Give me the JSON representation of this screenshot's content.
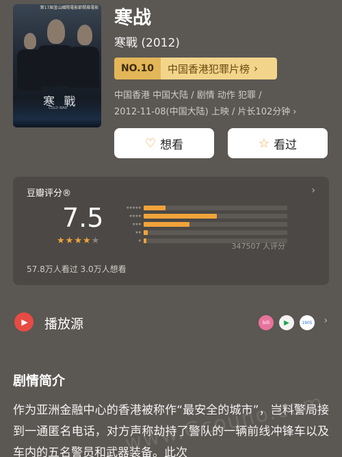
{
  "movie": {
    "title": "寒战",
    "original_title_year": "寒戰 (2012)",
    "poster": {
      "banner_text": "第17屆釜山國際電影節開幕電影",
      "poster_title": "寒 戰",
      "poster_subtitle": "COLD WAR"
    }
  },
  "ranking": {
    "number": "NO.10",
    "list_name": "中国香港犯罪片榜",
    "chevron": "chevron-right-icon"
  },
  "meta": {
    "line1": "中国香港 中国大陆 / 剧情 动作 犯罪 /",
    "line2": "2012-11-08(中国大陆) 上映 / 片长102分钟"
  },
  "actions": {
    "want_label": "想看",
    "want_icon": "heart-plus-icon",
    "seen_label": "看过",
    "seen_icon": "star-outline-icon"
  },
  "rating": {
    "label": "豆瓣评分®",
    "score": "7.5",
    "stars_filled": 4,
    "stars_total": 5,
    "distribution": [
      {
        "stars": "★★★★★",
        "fraction": 0.15
      },
      {
        "stars": "★★★★",
        "fraction": 0.51
      },
      {
        "stars": "★★★",
        "fraction": 0.32
      },
      {
        "stars": "★★",
        "fraction": 0.03
      },
      {
        "stars": "★",
        "fraction": 0.02
      }
    ],
    "votes": "347507 人评分",
    "watched_stats": "57.8万人看过   3.0万人想看",
    "accent_color": "#f2a33a"
  },
  "play": {
    "label": "播放源",
    "sources": [
      {
        "name": "bilibili",
        "icon": "bilibili-icon"
      },
      {
        "name": "iqiyi",
        "icon": "play-triangle-icon"
      },
      {
        "name": "1905电影网",
        "icon": "1905-icon"
      }
    ]
  },
  "synopsis": {
    "title": "剧情简介",
    "text": "作为亚洲金融中心的香港被称作“最安全的城市”，岂料警局接到一通匿名电话，对方声称劫持了警队的一辆前线冲锋车以及车内的五名警员和武器装备。此次"
  },
  "watermark": "www.Gcouno.com"
}
